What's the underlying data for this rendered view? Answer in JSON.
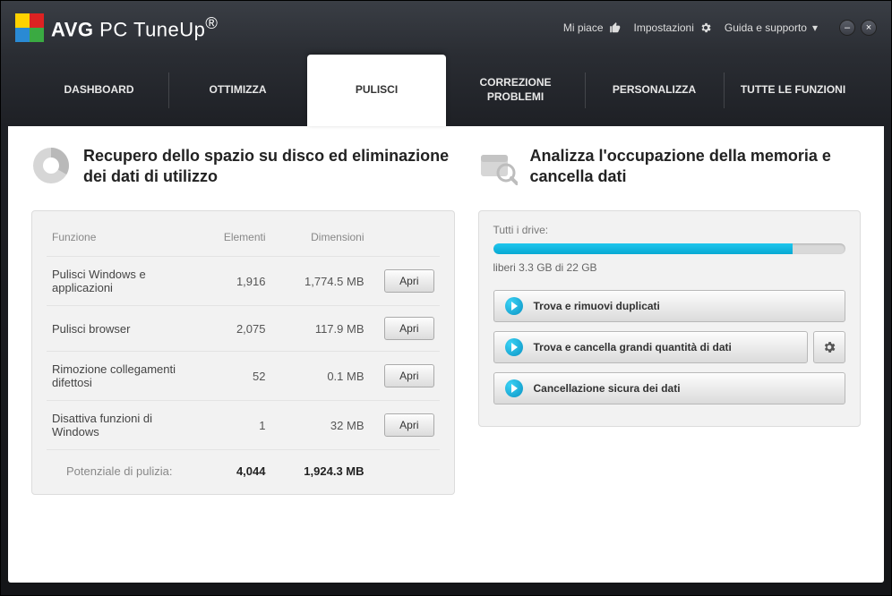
{
  "app": {
    "brand": "AVG",
    "product": "PC TuneUp",
    "reg": "®"
  },
  "titlebar": {
    "like": "Mi piace",
    "settings": "Impostazioni",
    "help": "Guida e supporto",
    "help_caret": "▾"
  },
  "tabs": [
    {
      "label": "DASHBOARD"
    },
    {
      "label": "OTTIMIZZA"
    },
    {
      "label": "PULISCI",
      "active": true
    },
    {
      "label": "CORREZIONE\nPROBLEMI"
    },
    {
      "label": "PERSONALIZZA"
    },
    {
      "label": "TUTTE LE FUNZIONI"
    }
  ],
  "left": {
    "title": "Recupero dello spazio su disco ed eliminazione dei dati di utilizzo",
    "headers": {
      "funzione": "Funzione",
      "elementi": "Elementi",
      "dimensioni": "Dimensioni"
    },
    "rows": [
      {
        "name": "Pulisci Windows e applicazioni",
        "elements": "1,916",
        "size": "1,774.5 MB",
        "action": "Apri"
      },
      {
        "name": "Pulisci browser",
        "elements": "2,075",
        "size": "117.9 MB",
        "action": "Apri"
      },
      {
        "name": "Rimozione collegamenti difettosi",
        "elements": "52",
        "size": "0.1 MB",
        "action": "Apri"
      },
      {
        "name": "Disattiva funzioni di Windows",
        "elements": "1",
        "size": "32 MB",
        "action": "Apri"
      }
    ],
    "total": {
      "label": "Potenziale di pulizia:",
      "elements": "4,044",
      "size": "1,924.3 MB"
    }
  },
  "right": {
    "title": "Analizza l'occupazione della memoria e cancella dati",
    "drive_label": "Tutti i drive:",
    "free_text": "liberi 3.3 GB di 22 GB",
    "usage_percent": 85,
    "actions": [
      {
        "label": "Trova e rimuovi duplicati",
        "gear": false
      },
      {
        "label": "Trova e cancella grandi quantità di dati",
        "gear": true
      },
      {
        "label": "Cancellazione sicura dei dati",
        "gear": false
      }
    ]
  }
}
